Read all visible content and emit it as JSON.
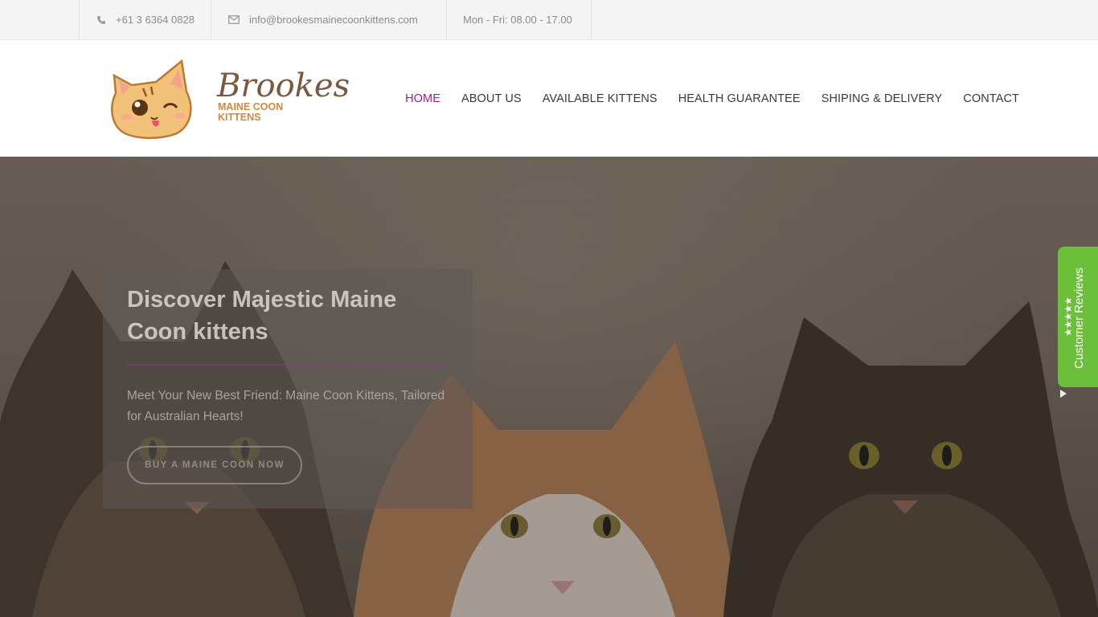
{
  "topbar": {
    "phone": "+61 3 6364 0828",
    "email": "info@brookesmainecoonkittens.com",
    "hours": "Mon - Fri: 08.00 - 17.00"
  },
  "logo": {
    "brand": "Brookes",
    "sub_line1": "MAINE COON",
    "sub_line2": "KITTENS"
  },
  "nav": {
    "items": [
      {
        "label": "HOME",
        "active": true
      },
      {
        "label": "ABOUT US"
      },
      {
        "label": "AVAILABLE KITTENS"
      },
      {
        "label": "HEALTH GUARANTEE"
      },
      {
        "label": "SHIPING & DELIVERY"
      },
      {
        "label": "CONTACT"
      }
    ]
  },
  "hero": {
    "title": "Discover Majestic Maine Coon kittens",
    "subtitle": "Meet Your New Best Friend: Maine Coon Kittens, Tailored for Australian Hearts!",
    "button": "BUY A MAINE COON NOW"
  },
  "reviews": {
    "label": "Customer Reviews",
    "stars": "★★★★★"
  },
  "colors": {
    "accent": "#9b1f8f",
    "reviews_green": "#6cbf3a",
    "logo_orange": "#d28a3a"
  }
}
